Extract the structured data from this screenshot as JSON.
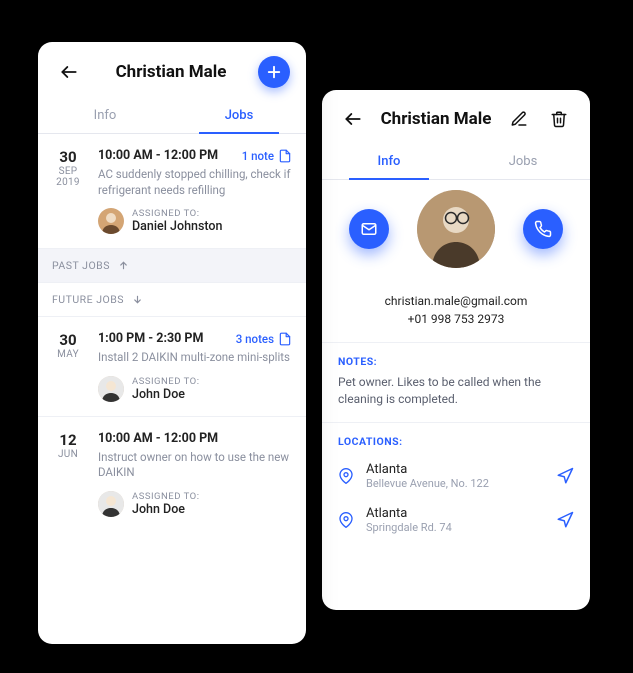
{
  "colors": {
    "accent": "#2a5fff"
  },
  "jobs_card": {
    "title": "Christian Male",
    "tabs": {
      "info": "Info",
      "jobs": "Jobs"
    },
    "past_label": "PAST JOBS",
    "future_label": "FUTURE JOBS",
    "assigned_label": "ASSIGNED TO:",
    "jobs": [
      {
        "day": "30",
        "month": "SEP",
        "year": "2019",
        "time": "10:00 AM - 12:00 PM",
        "notes": "1 note",
        "desc": "AC suddenly stopped chilling, check if refrigerant needs refilling",
        "assignee": "Daniel Johnston"
      },
      {
        "day": "30",
        "month": "MAY",
        "year": "",
        "time": "1:00 PM - 2:30 PM",
        "notes": "3 notes",
        "desc": "Install 2 DAIKIN multi-zone mini-splits",
        "assignee": "John Doe"
      },
      {
        "day": "12",
        "month": "JUN",
        "year": "",
        "time": "10:00 AM - 12:00 PM",
        "notes": "",
        "desc": "Instruct owner on how to use the new DAIKIN",
        "assignee": "John Doe"
      }
    ]
  },
  "info_card": {
    "title": "Christian Male",
    "tabs": {
      "info": "Info",
      "jobs": "Jobs"
    },
    "email": "christian.male@gmail.com",
    "phone": "+01 998 753 2973",
    "notes_heading": "NOTES:",
    "notes_body": "Pet owner. Likes to be called when the cleaning is completed.",
    "locations_heading": "LOCATIONS:",
    "locations": [
      {
        "city": "Atlanta",
        "addr": "Bellevue Avenue, No. 122"
      },
      {
        "city": "Atlanta",
        "addr": "Springdale Rd. 74"
      }
    ]
  }
}
